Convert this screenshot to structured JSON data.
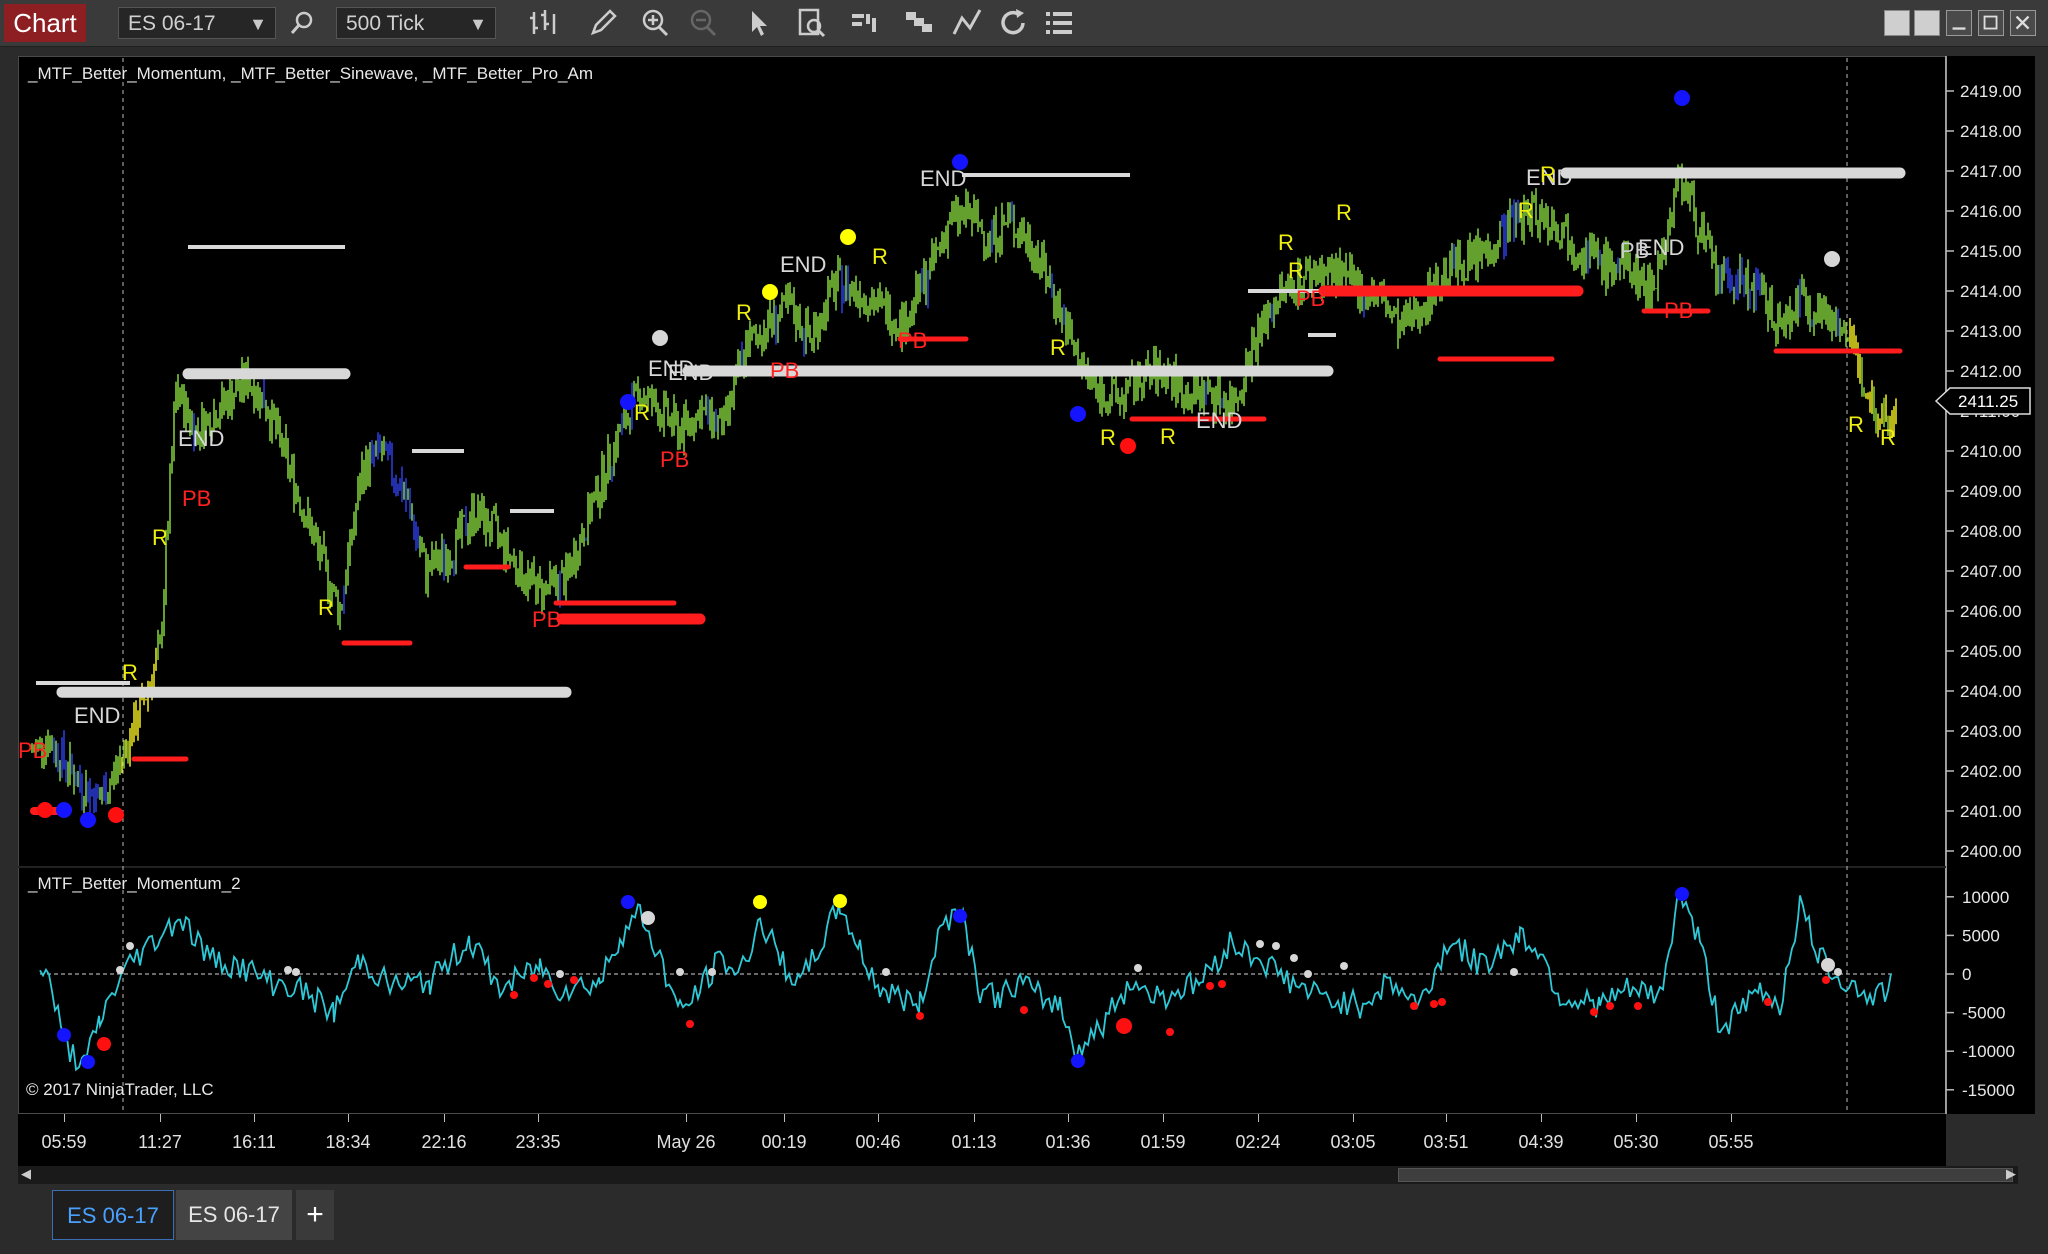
{
  "toolbar": {
    "chart_tab": "Chart",
    "instrument": "ES 06-17",
    "interval": "500 Tick"
  },
  "indicators": {
    "price_panel_label": "_MTF_Better_Momentum, _MTF_Better_Sinewave, _MTF_Better_Pro_Am",
    "momentum_panel_label": "_MTF_Better_Momentum_2"
  },
  "copyright": "© 2017 NinjaTrader, LLC",
  "price_axis": {
    "ticks": [
      "2419.00",
      "2418.00",
      "2417.00",
      "2416.00",
      "2415.00",
      "2414.00",
      "2413.00",
      "2412.00",
      "2411.00",
      "2410.00",
      "2409.00",
      "2408.00",
      "2407.00",
      "2406.00",
      "2405.00",
      "2404.00",
      "2403.00",
      "2402.00",
      "2401.00",
      "2400.00"
    ],
    "current_price": "2411.25"
  },
  "momentum_axis": {
    "ticks": [
      "10000",
      "5000",
      "0",
      "-5000",
      "-10000",
      "-15000"
    ]
  },
  "time_axis": {
    "labels": [
      "05:59",
      "11:27",
      "16:11",
      "18:34",
      "22:16",
      "23:35",
      "May 26",
      "00:19",
      "00:46",
      "01:13",
      "01:36",
      "01:59",
      "02:24",
      "03:05",
      "03:51",
      "04:39",
      "05:30",
      "05:55"
    ]
  },
  "annotations": {
    "end": "END",
    "pb": "PB",
    "r": "R"
  },
  "colors": {
    "up_bar": "#7ec93a",
    "down_bar": "#2a3bd6",
    "pullback_bar": "#e6e01e",
    "white_line": "#d8d8d8",
    "red_line": "#ff1c1c",
    "momentum_line": "#2ec8d6",
    "dot_blue": "#1414ff",
    "dot_yellow": "#ffff00",
    "dot_red": "#ff1010",
    "dot_white": "#d6d6d6"
  },
  "bottom_tabs": {
    "active": "ES 06-17",
    "other": "ES 06-17",
    "add": "+"
  }
}
